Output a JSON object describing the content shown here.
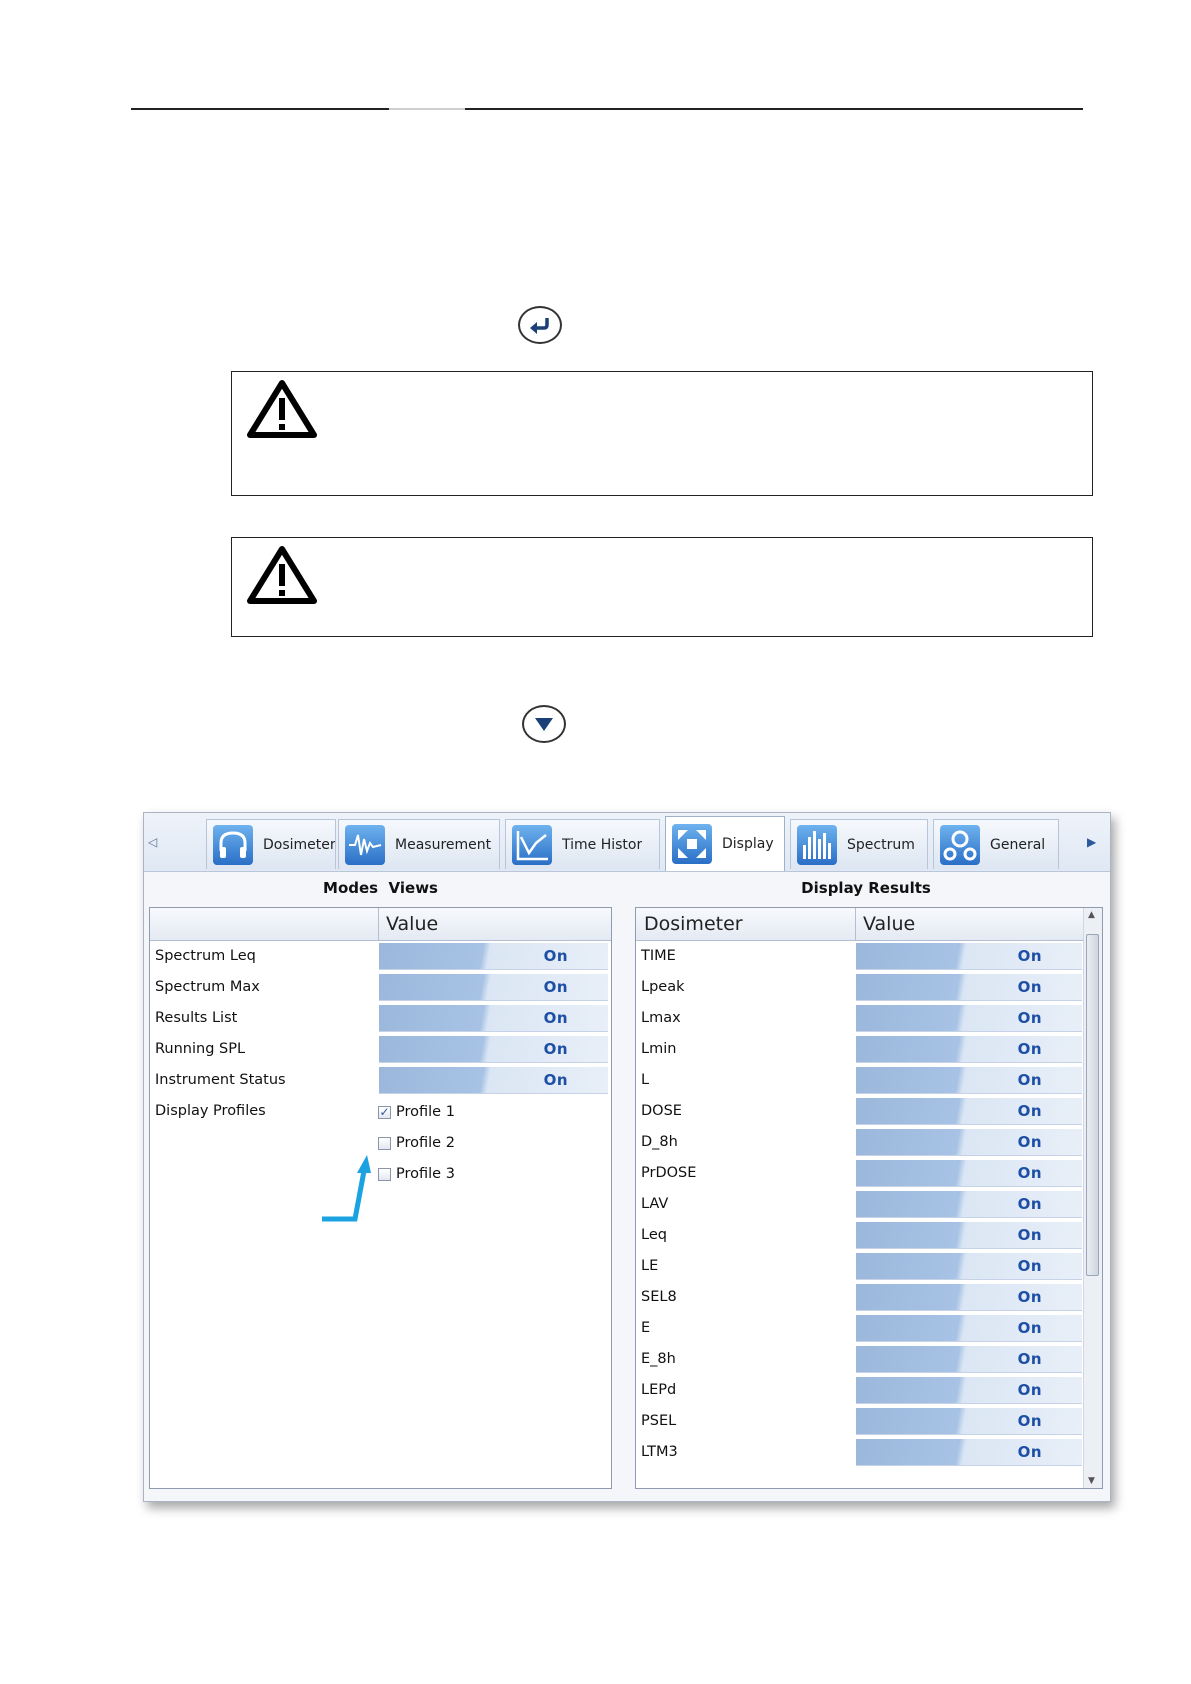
{
  "document": {
    "return_icon": "return-arrow-icon",
    "down_icon": "down-triangle-icon",
    "warning_icon": "warning-triangle-icon"
  },
  "screenshot": {
    "tabs": [
      {
        "label": "Dosimeter",
        "icon": "headphones-icon"
      },
      {
        "label": "Measurement",
        "icon": "waveform-icon"
      },
      {
        "label": "Time Histor",
        "icon": "line-chart-icon"
      },
      {
        "label": "Display",
        "icon": "expand-arrows-icon",
        "active": true
      },
      {
        "label": "Spectrum",
        "icon": "bar-spectrum-icon"
      },
      {
        "label": "General",
        "icon": "gears-icon"
      }
    ],
    "left_panel": {
      "title": "Modes  Views",
      "header_value": "Value",
      "rows": [
        {
          "label": "Spectrum Leq",
          "value": "On"
        },
        {
          "label": "Spectrum Max",
          "value": "On"
        },
        {
          "label": "Results List",
          "value": "On"
        },
        {
          "label": "Running SPL",
          "value": "On"
        },
        {
          "label": "Instrument Status",
          "value": "On"
        }
      ],
      "profiles_label": "Display Profiles",
      "profiles": [
        {
          "label": "Profile 1",
          "checked": true
        },
        {
          "label": "Profile 2",
          "checked": false
        },
        {
          "label": "Profile 3",
          "checked": false
        }
      ]
    },
    "right_panel": {
      "title": "Display Results",
      "header_name": "Dosimeter",
      "header_value": "Value",
      "rows": [
        {
          "label": "TIME",
          "value": "On"
        },
        {
          "label": "Lpeak",
          "value": "On"
        },
        {
          "label": "Lmax",
          "value": "On"
        },
        {
          "label": "Lmin",
          "value": "On"
        },
        {
          "label": "L",
          "value": "On"
        },
        {
          "label": "DOSE",
          "value": "On"
        },
        {
          "label": "D_8h",
          "value": "On"
        },
        {
          "label": "PrDOSE",
          "value": "On"
        },
        {
          "label": "LAV",
          "value": "On"
        },
        {
          "label": "Leq",
          "value": "On"
        },
        {
          "label": "LE",
          "value": "On"
        },
        {
          "label": "SEL8",
          "value": "On"
        },
        {
          "label": "E",
          "value": "On"
        },
        {
          "label": "E_8h",
          "value": "On"
        },
        {
          "label": "LEPd",
          "value": "On"
        },
        {
          "label": "PSEL",
          "value": "On"
        },
        {
          "label": "LTM3",
          "value": "On"
        }
      ]
    },
    "colors": {
      "accent": "#1d4fa6",
      "arrow": "#1aa3e0"
    }
  }
}
